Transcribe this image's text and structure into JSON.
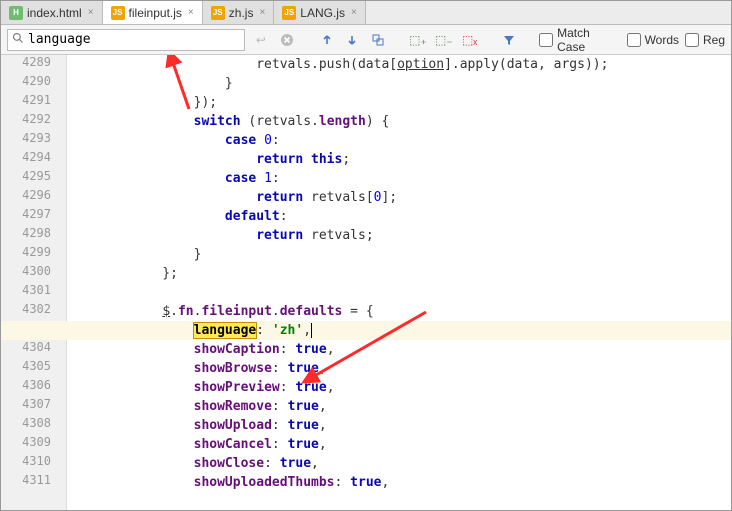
{
  "tabs": [
    {
      "icon": "html",
      "label": "index.html",
      "active": false
    },
    {
      "icon": "js",
      "label": "fileinput.js",
      "active": true
    },
    {
      "icon": "js",
      "label": "zh.js",
      "active": false
    },
    {
      "icon": "js",
      "label": "LANG.js",
      "active": false
    }
  ],
  "search": {
    "query": "language",
    "placeholder": ""
  },
  "options": {
    "matchCase": "Match Case",
    "words": "Words",
    "regex": "Reg"
  },
  "code": {
    "startLine": 4289,
    "bulbLine": 4303,
    "lines": [
      "                retvals.push(data[option].apply(data, args));",
      "            }",
      "        });",
      "        switch (retvals.length) {",
      "            case 0:",
      "                return this;",
      "            case 1:",
      "                return retvals[0];",
      "            default:",
      "                return retvals;",
      "        }",
      "    };",
      "",
      "    $.fn.fileinput.defaults = {",
      "        language: 'zh',",
      "        showCaption: true,",
      "        showBrowse: true,",
      "        showPreview: true,",
      "        showRemove: true,",
      "        showUpload: true,",
      "        showCancel: true,",
      "        showClose: true,",
      "        showUploadedThumbs: true,"
    ]
  }
}
